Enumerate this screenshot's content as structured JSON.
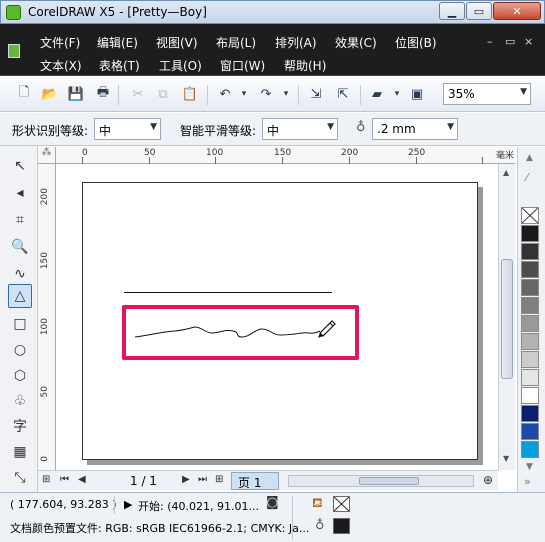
{
  "window": {
    "title": "CorelDRAW X5 - [Pretty—Boy]"
  },
  "menubar": {
    "row1": [
      "文件(F)",
      "编辑(E)",
      "视图(V)",
      "布局(L)",
      "排列(A)",
      "效果(C)",
      "位图(B)"
    ],
    "row2": [
      "文本(X)",
      "表格(T)",
      "工具(O)",
      "窗口(W)",
      "帮助(H)"
    ]
  },
  "toolbar": {
    "zoom": "35%"
  },
  "propbar": {
    "shape_recognition_label": "形状识别等级:",
    "shape_recognition_value": "中",
    "smooth_label": "智能平滑等级:",
    "smooth_value": "中",
    "outline_width": ".2 mm"
  },
  "ruler": {
    "h_labels": [
      "0",
      "50",
      "100",
      "150",
      "200",
      "250"
    ],
    "h_unit": "毫米",
    "v_labels": [
      "200",
      "150",
      "100",
      "50",
      "0"
    ]
  },
  "page_nav": {
    "count": "1 / 1",
    "tab": "页 1"
  },
  "status": {
    "coords": "( 177.604, 93.283 )",
    "start": "开始: (40.021, 91.01...",
    "color_profile": "文档颜色预置文件: RGB: sRGB IEC61966-2.1; CMYK: Ja..."
  },
  "palette": {
    "colors": [
      "#ffffff",
      "#1a1a1a",
      "#333333",
      "#4d4d4d",
      "#666666",
      "#808080",
      "#999999",
      "#b3b3b3",
      "#cccccc",
      "#e6e6e6",
      "#ffffff",
      "#0a1f6e",
      "#1c4aa8",
      "#00a0e3"
    ]
  },
  "icons": {
    "tools": [
      "pick-tool-icon",
      "shape-tool-icon",
      "crop-tool-icon",
      "zoom-tool-icon",
      "freehand-tool-icon",
      "smart-drawing-tool-icon",
      "rectangle-tool-icon",
      "ellipse-tool-icon",
      "polygon-tool-icon",
      "basic-shapes-icon",
      "text-tool-icon",
      "table-tool-icon",
      "dimension-tool-icon"
    ]
  }
}
